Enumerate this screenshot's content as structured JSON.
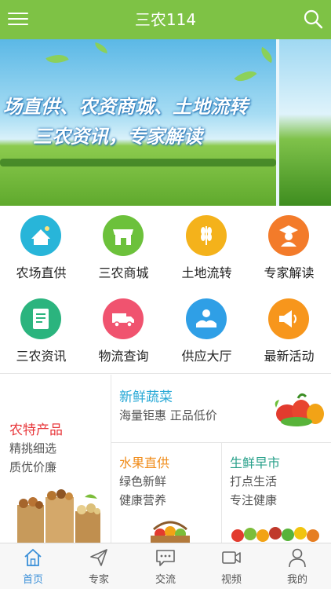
{
  "header": {
    "title": "三农114",
    "menu_icon": "hamburger-icon",
    "search_icon": "search-icon"
  },
  "banner": {
    "line1": "场直供、农资商城、土地流转",
    "line2": "三农资讯，专家解读"
  },
  "categories": [
    {
      "label": "农场直供",
      "icon": "farm-icon",
      "color": "#28b5d9"
    },
    {
      "label": "三农商城",
      "icon": "store-icon",
      "color": "#6cc13b"
    },
    {
      "label": "土地流转",
      "icon": "wheat-icon",
      "color": "#f4b21b"
    },
    {
      "label": "专家解读",
      "icon": "expert-icon",
      "color": "#f37b2a"
    },
    {
      "label": "三农资讯",
      "icon": "news-icon",
      "color": "#2bb47e"
    },
    {
      "label": "物流查询",
      "icon": "truck-icon",
      "color": "#f0536f"
    },
    {
      "label": "供应大厅",
      "icon": "supply-icon",
      "color": "#2f9fe6"
    },
    {
      "label": "最新活动",
      "icon": "megaphone-icon",
      "color": "#f7961c"
    }
  ],
  "promo": {
    "specialty": {
      "title": "农特产品",
      "line1": "精挑细选",
      "line2": "质优价廉",
      "title_color": "#e8373b"
    },
    "vegetables": {
      "title": "新鲜蔬菜",
      "line1": "海量钜惠 正品低价",
      "title_color": "#29a9d6"
    },
    "fruit": {
      "title": "水果直供",
      "line1": "绿色新鲜",
      "line2": "健康营养",
      "title_color": "#f08c1a"
    },
    "market": {
      "title": "生鲜早市",
      "line1": "打点生活",
      "line2": "专注健康",
      "title_color": "#27a08a"
    }
  },
  "nav": [
    {
      "label": "首页",
      "icon": "home-icon",
      "active": true
    },
    {
      "label": "专家",
      "icon": "send-icon",
      "active": false
    },
    {
      "label": "交流",
      "icon": "chat-icon",
      "active": false
    },
    {
      "label": "视频",
      "icon": "video-icon",
      "active": false
    },
    {
      "label": "我的",
      "icon": "user-icon",
      "active": false
    }
  ]
}
